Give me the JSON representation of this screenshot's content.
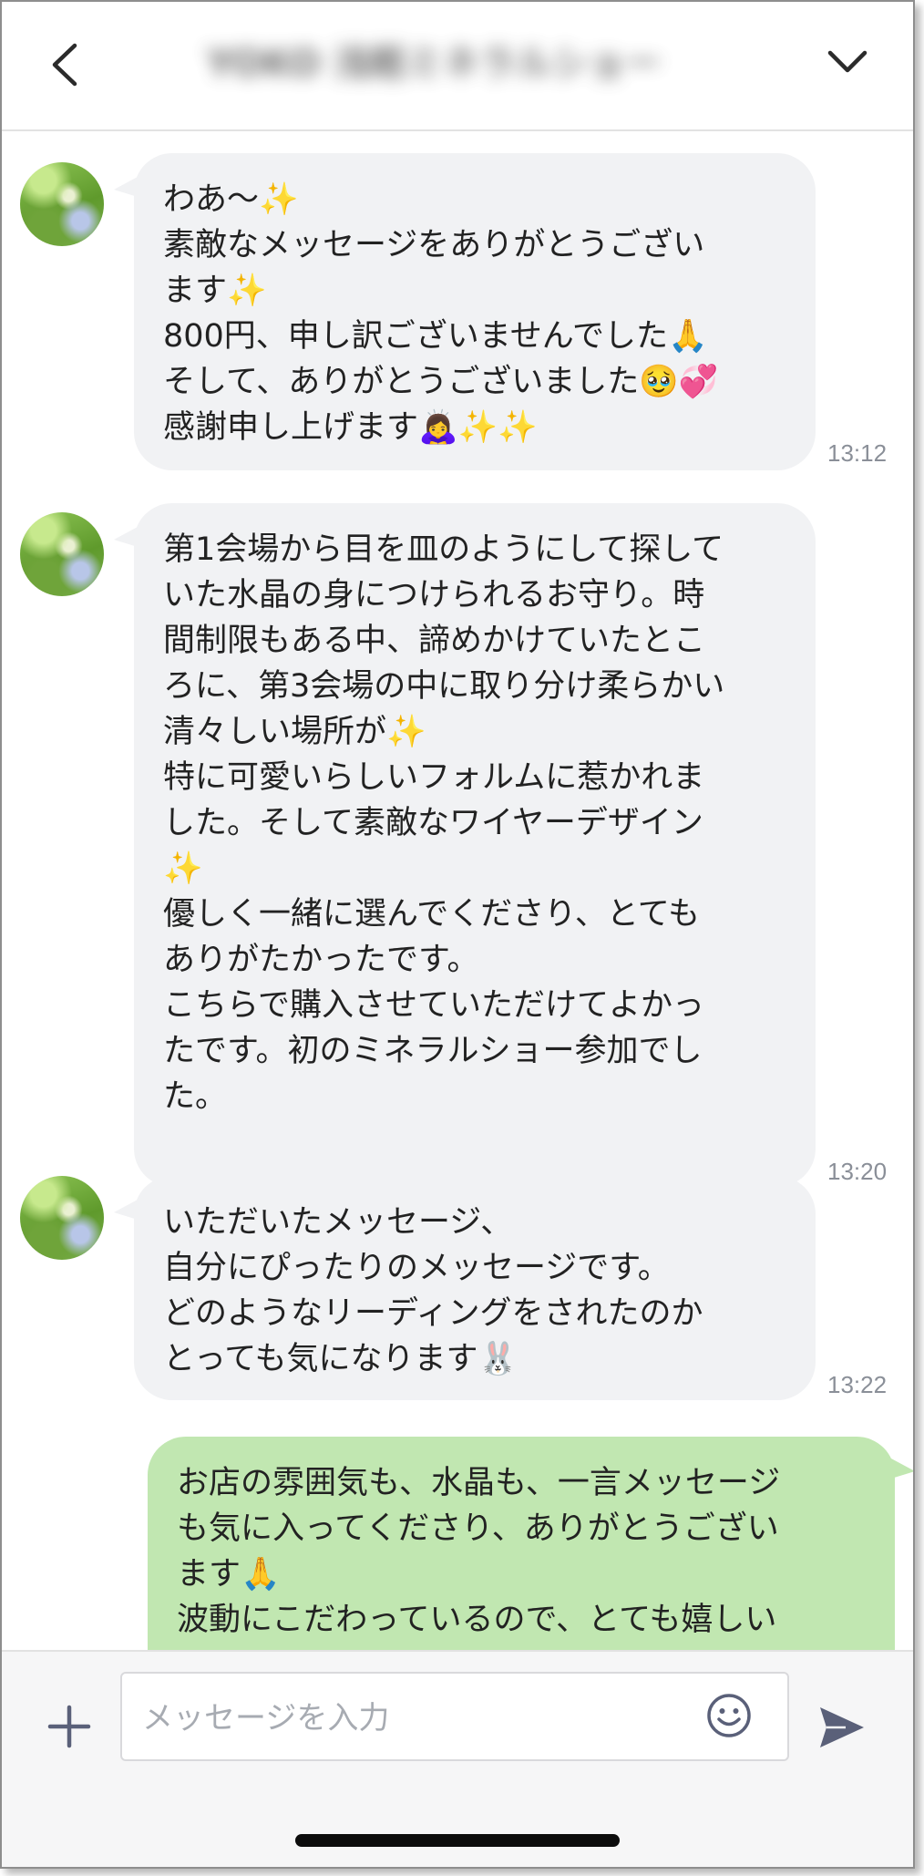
{
  "header": {
    "title": "YOKO 浅眠ミネラルショー",
    "back_icon": "chevron-left-icon",
    "menu_icon": "chevron-down-icon"
  },
  "messages": [
    {
      "side": "incoming",
      "text": "わあ〜✨\n素敵なメッセージをありがとうござい\nます✨\n800円、申し訳ございませんでした🙏\nそして、ありがとうございました🥹💞\n感謝申し上げます🙇‍♀️✨✨",
      "time": "13:12"
    },
    {
      "side": "incoming",
      "text": "第1会場から目を皿のようにして探して\nいた水晶の身につけられるお守り。時\n間制限もある中、諦めかけていたとこ\nろに、第3会場の中に取り分け柔らかい\n清々しい場所が✨\n特に可愛いらしいフォルムに惹かれま\nした。そして素敵なワイヤーデザイン\n✨\n優しく一緒に選んでくださり、とても\nありがたかったです。\nこちらで購入させていただけてよかっ\nたです。初のミネラルショー参加でし\nた。",
      "time": "13:20"
    },
    {
      "side": "incoming",
      "text": "いただいたメッセージ、\n自分にぴったりのメッセージです。\nどのようなリーディングをされたのか\nとっても気になります🐰",
      "time": "13:22"
    },
    {
      "side": "outgoing",
      "text": "お店の雰囲気も、水晶も、一言メッセージ\nも気に入ってくださり、ありがとうござい\nます🙏\n波動にこだわっているので、とても嬉しい",
      "time": ""
    }
  ],
  "input": {
    "placeholder": "メッセージを入力",
    "plus_icon": "plus-icon",
    "emoji_icon": "smile-icon",
    "send_icon": "send-icon"
  },
  "colors": {
    "incoming_bubble": "#f1f2f4",
    "outgoing_bubble": "#c1e7b1",
    "icon": "#5a6079",
    "timestamp": "#8a8f98"
  }
}
